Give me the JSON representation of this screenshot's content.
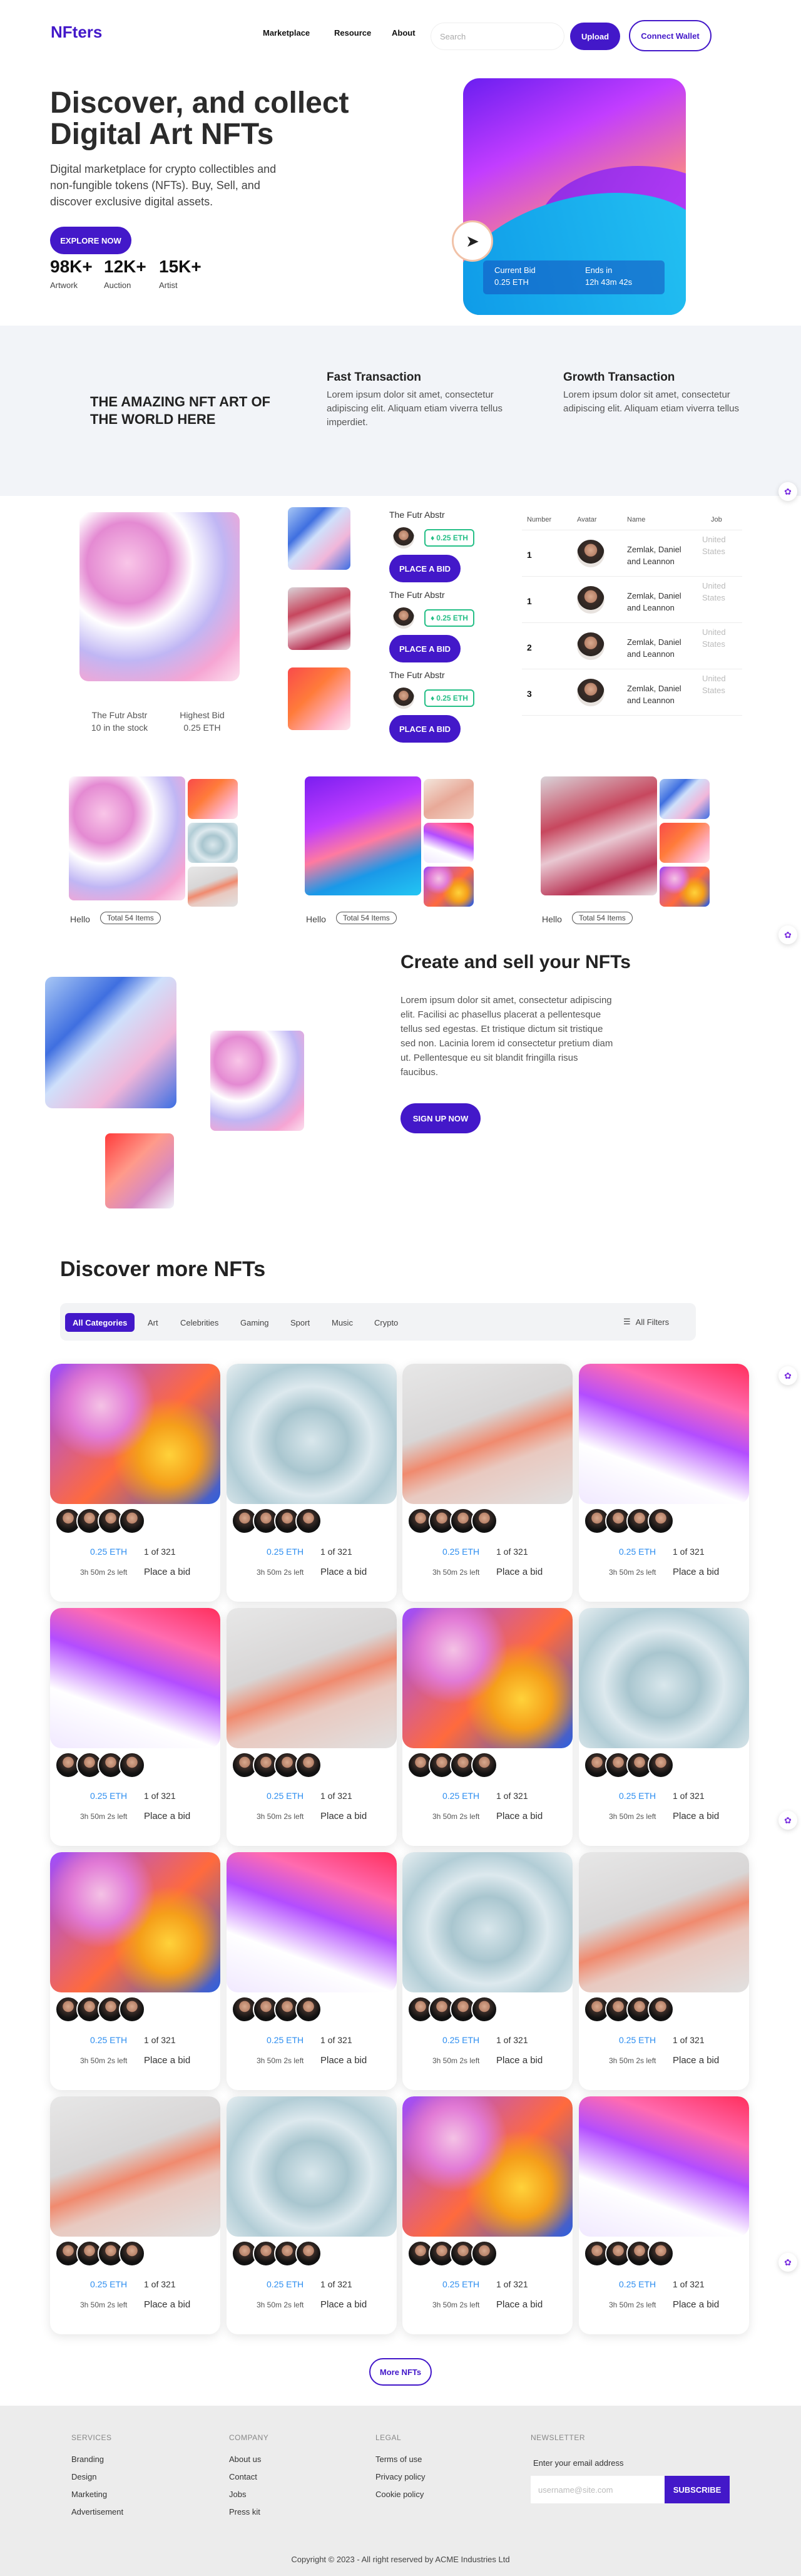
{
  "header": {
    "logo": "NFters",
    "nav": [
      "Marketplace",
      "Resource",
      "About"
    ],
    "search_placeholder": "Search",
    "upload_label": "Upload",
    "wallet_label": "Connect Wallet"
  },
  "hero": {
    "title": "Discover, and collect Digital Art NFTs",
    "subtitle": "Digital marketplace for crypto collectibles and non-fungible tokens (NFTs). Buy, Sell, and discover exclusive digital assets.",
    "cta": "EXPLORE NOW",
    "stats": [
      {
        "value": "98K+",
        "label": "Artwork"
      },
      {
        "value": "12K+",
        "label": "Auction"
      },
      {
        "value": "15K+",
        "label": "Artist"
      }
    ],
    "card": {
      "current_bid_label": "Current Bid",
      "current_bid_value": "0.25 ETH",
      "ends_label": "Ends in",
      "ends_value": "12h 43m 42s"
    }
  },
  "features": {
    "headline": "THE AMAZING NFT ART OF THE WORLD HERE",
    "items": [
      {
        "title": "Fast Transaction",
        "text": "Lorem ipsum dolor sit amet, consectetur adipiscing elit. Aliquam etiam viverra tellus imperdiet."
      },
      {
        "title": "Growth Transaction",
        "text": "Lorem ipsum dolor sit amet, consectetur adipiscing elit. Aliquam etiam viverra tellus"
      }
    ]
  },
  "featured": {
    "art_name": "The Futr Abstr",
    "stock": "10 in the stock",
    "highest_bid_label": "Highest Bid",
    "highest_bid_value": "0.25 ETH",
    "bids": [
      {
        "title": "The Futr Abstr",
        "eth": "0.25 ETH",
        "button": "PLACE A BID"
      },
      {
        "title": "The Futr Abstr",
        "eth": "0.25 ETH",
        "button": "PLACE A BID"
      },
      {
        "title": "The Futr Abstr",
        "eth": "0.25 ETH",
        "button": "PLACE A BID"
      }
    ]
  },
  "table": {
    "headers": [
      "Number",
      "Avatar",
      "Name",
      "Job"
    ],
    "rows": [
      {
        "number": "1",
        "name": "Zemlak, Daniel and Leannon",
        "job": "United States"
      },
      {
        "number": "1",
        "name": "Zemlak, Daniel and Leannon",
        "job": "United States"
      },
      {
        "number": "2",
        "name": "Zemlak, Daniel and Leannon",
        "job": "United States"
      },
      {
        "number": "3",
        "name": "Zemlak, Daniel and Leannon",
        "job": "United States"
      }
    ]
  },
  "collections": [
    {
      "label": "Hello",
      "pill": "Total 54 Items"
    },
    {
      "label": "Hello",
      "pill": "Total 54 Items"
    },
    {
      "label": "Hello",
      "pill": "Total 54 Items"
    }
  ],
  "create": {
    "title": "Create and sell your NFTs",
    "text": "Lorem ipsum dolor sit amet, consectetur adipiscing elit. Facilisi ac phasellus placerat a pellentesque tellus sed egestas. Et tristique dictum sit tristique sed non. Lacinia lorem id consectetur pretium diam ut. Pellentesque eu sit blandit fringilla risus faucibus.",
    "cta": "SIGN UP NOW"
  },
  "discover": {
    "title": "Discover more NFTs",
    "categories": [
      "All Categories",
      "Art",
      "Celebrities",
      "Gaming",
      "Sport",
      "Music",
      "Crypto"
    ],
    "all_filters": "All Filters",
    "card": {
      "eth": "0.25 ETH",
      "of": "1 of 321",
      "time": "3h 50m 2s left",
      "bid": "Place a bid"
    },
    "more": "More NFTs"
  },
  "footer": {
    "services_head": "SERVICES",
    "services": [
      "Branding",
      "Design",
      "Marketing",
      "Advertisement"
    ],
    "company_head": "COMPANY",
    "company": [
      "About us",
      "Contact",
      "Jobs",
      "Press kit"
    ],
    "legal_head": "LEGAL",
    "legal": [
      "Terms of use",
      "Privacy policy",
      "Cookie policy"
    ],
    "newsletter_head": "NEWSLETTER",
    "newsletter_label": "Enter your email address",
    "newsletter_placeholder": "username@site.com",
    "subscribe": "SUBSCRIBE",
    "copyright": "Copyright © 2023 - All right reserved by ACME Industries Ltd"
  }
}
